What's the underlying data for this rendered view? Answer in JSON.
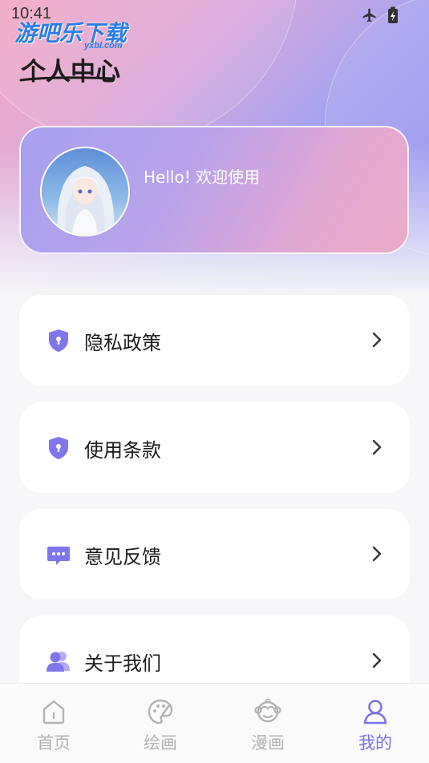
{
  "status_bar": {
    "time": "10:41",
    "icons": [
      "airplane-icon",
      "battery-charging-icon"
    ]
  },
  "watermark": {
    "text": "游吧乐下载",
    "sub": "yxbl.com"
  },
  "page": {
    "title": "个人中心"
  },
  "profile": {
    "greeting": "Hello! 欢迎使用",
    "avatar": "anime-girl-avatar"
  },
  "menu": {
    "items": [
      {
        "label": "隐私政策",
        "icon": "shield-icon"
      },
      {
        "label": "使用条款",
        "icon": "shield-icon"
      },
      {
        "label": "意见反馈",
        "icon": "chat-bubble-icon"
      },
      {
        "label": "关于我们",
        "icon": "users-icon"
      }
    ]
  },
  "tabbar": {
    "items": [
      {
        "label": "首页",
        "icon": "home-icon",
        "active": false
      },
      {
        "label": "绘画",
        "icon": "palette-icon",
        "active": false
      },
      {
        "label": "漫画",
        "icon": "monkey-icon",
        "active": false
      },
      {
        "label": "我的",
        "icon": "user-icon",
        "active": true
      }
    ]
  },
  "colors": {
    "accent": "#7c72ea",
    "icon": "#7f76ee",
    "inactive": "#b3b3b3"
  }
}
